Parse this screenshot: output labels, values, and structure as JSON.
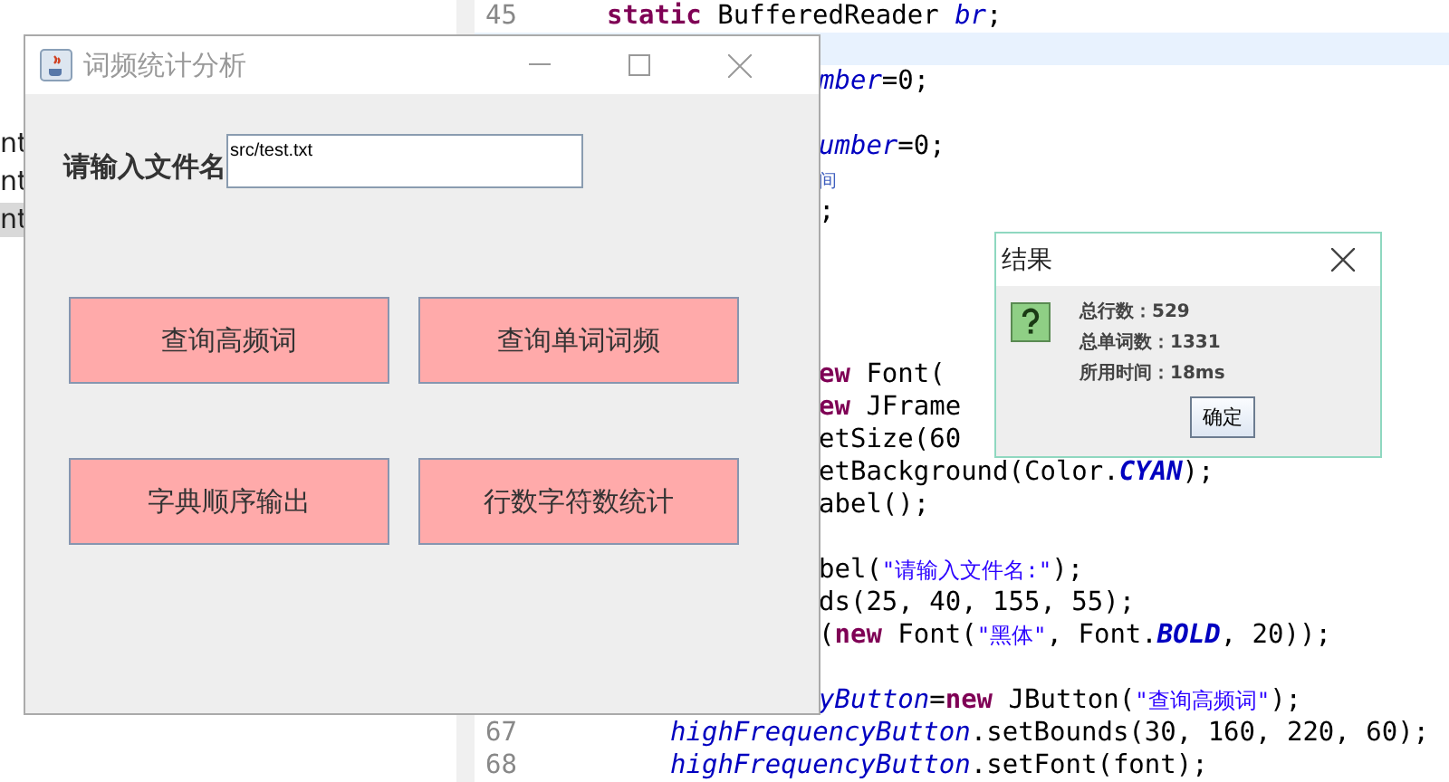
{
  "left_panel": {
    "items": [
      {
        "label": "nt",
        "selected": false
      },
      {
        "label": "nt",
        "selected": false
      },
      {
        "label": "nt",
        "selected": true
      }
    ]
  },
  "editor": {
    "rows": [
      {
        "number": "45",
        "kind": "member",
        "highlighted": false,
        "tokens": [
          {
            "kind": "keyword",
            "text": "static"
          },
          {
            "kind": "plain",
            "text": " BufferedReader "
          },
          {
            "kind": "field",
            "text": "br"
          },
          {
            "kind": "plain",
            "text": ";"
          }
        ]
      },
      {
        "highlighted": true
      },
      {
        "kind": "cut",
        "highlighted": false,
        "tokens": [
          {
            "kind": "field",
            "text": "mber"
          },
          {
            "kind": "plain",
            "text": "=0;"
          }
        ]
      },
      {
        "highlighted": false
      },
      {
        "kind": "cut",
        "highlighted": false,
        "tokens": [
          {
            "kind": "field",
            "text": "umber"
          },
          {
            "kind": "plain",
            "text": "=0;"
          }
        ]
      },
      {
        "kind": "cut",
        "highlighted": false,
        "tokens": [
          {
            "kind": "comment",
            "text": "间"
          }
        ]
      },
      {
        "kind": "cut",
        "highlighted": false,
        "tokens": [
          {
            "kind": "plain",
            "text": ";"
          }
        ]
      },
      {
        "highlighted": false
      },
      {
        "highlighted": false
      },
      {
        "highlighted": false
      },
      {
        "highlighted": false
      },
      {
        "kind": "cut",
        "highlighted": false,
        "tokens": [
          {
            "kind": "keyword",
            "text": "ew"
          },
          {
            "kind": "plain",
            "text": " Font("
          }
        ]
      },
      {
        "kind": "cut",
        "highlighted": false,
        "tokens": [
          {
            "kind": "keyword",
            "text": "ew"
          },
          {
            "kind": "plain",
            "text": " JFrame"
          }
        ]
      },
      {
        "kind": "cut",
        "highlighted": false,
        "tokens": [
          {
            "kind": "plain",
            "text": "etSize(60"
          }
        ]
      },
      {
        "kind": "cut",
        "highlighted": false,
        "tokens": [
          {
            "kind": "plain",
            "text": "etBackground(Color."
          },
          {
            "kind": "constant",
            "text": "CYAN"
          },
          {
            "kind": "plain",
            "text": ");"
          }
        ]
      },
      {
        "kind": "cut",
        "highlighted": false,
        "tokens": [
          {
            "kind": "plain",
            "text": "abel();"
          }
        ]
      },
      {
        "highlighted": false
      },
      {
        "kind": "cut",
        "highlighted": false,
        "tokens": [
          {
            "kind": "plain",
            "text": "bel("
          },
          {
            "kind": "string",
            "text": "\"请输入文件名:\""
          },
          {
            "kind": "plain",
            "text": ");"
          }
        ]
      },
      {
        "kind": "cut",
        "highlighted": false,
        "tokens": [
          {
            "kind": "plain",
            "text": "ds(25, 40, 155, 55);"
          }
        ]
      },
      {
        "kind": "cut",
        "highlighted": false,
        "tokens": [
          {
            "kind": "plain",
            "text": "("
          },
          {
            "kind": "keyword",
            "text": "new"
          },
          {
            "kind": "plain",
            "text": " Font("
          },
          {
            "kind": "string",
            "text": "\"黑体\""
          },
          {
            "kind": "plain",
            "text": ", Font."
          },
          {
            "kind": "constant",
            "text": "BOLD"
          },
          {
            "kind": "plain",
            "text": ", 20));"
          }
        ]
      },
      {
        "highlighted": false
      },
      {
        "kind": "cut",
        "highlighted": false,
        "tokens": [
          {
            "kind": "field",
            "text": "yButton"
          },
          {
            "kind": "plain",
            "text": "="
          },
          {
            "kind": "keyword",
            "text": "new"
          },
          {
            "kind": "plain",
            "text": " JButton("
          },
          {
            "kind": "string",
            "text": "\"查询高频词\""
          },
          {
            "kind": "plain",
            "text": ");"
          }
        ]
      },
      {
        "number": "67",
        "kind": "statement",
        "highlighted": false,
        "tokens": [
          {
            "kind": "field",
            "text": "highFrequencyButton"
          },
          {
            "kind": "plain",
            "text": ".setBounds(30, 160, 220, 60);"
          }
        ]
      },
      {
        "number": "68",
        "kind": "statement",
        "highlighted": false,
        "tokens": [
          {
            "kind": "field",
            "text": "highFrequencyButton"
          },
          {
            "kind": "plain",
            "text": ".setFont(font);"
          }
        ]
      }
    ]
  },
  "main_window": {
    "title": "词频统计分析",
    "label": "请输入文件名",
    "file_field": {
      "value": "src/test.txt"
    },
    "buttons": [
      "查询高频词",
      "查询单词词频",
      "字典顺序输出",
      "行数字符数统计"
    ]
  },
  "dialog": {
    "title": "结果",
    "lines": [
      "总行数：529",
      "总单词数：1331",
      "所用时间：18ms"
    ],
    "button": "确定"
  }
}
